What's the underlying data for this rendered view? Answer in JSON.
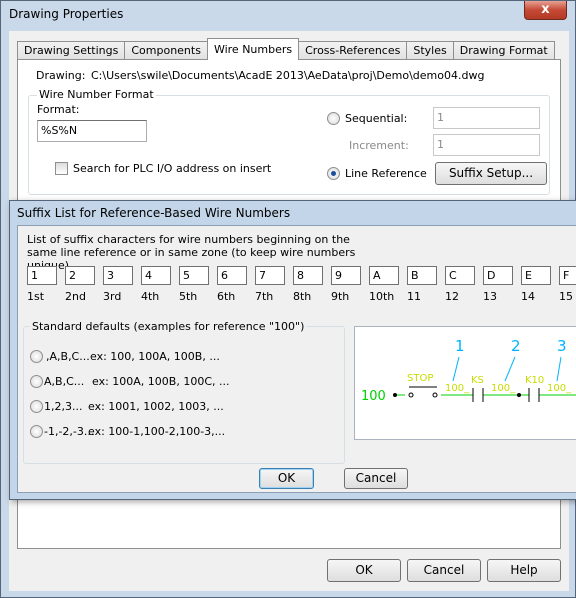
{
  "main": {
    "title": "Drawing Properties",
    "close_glyph": "x",
    "tabs": [
      "Drawing Settings",
      "Components",
      "Wire Numbers",
      "Cross-References",
      "Styles",
      "Drawing Format"
    ],
    "active_tab": "Wire Numbers",
    "drawing_label": "Drawing:",
    "drawing_path": "C:\\Users\\swile\\Documents\\AcadE 2013\\AeData\\proj\\Demo\\demo04.dwg",
    "group_label": "Wire Number Format",
    "format_label": "Format:",
    "format_value": "%S%N",
    "plc_label": "Search for PLC I/O address on insert",
    "sequential_label": "Sequential:",
    "sequential_value": "1",
    "increment_label": "Increment:",
    "increment_value": "1",
    "line_reference_label": "Line Reference",
    "suffix_button": "Suffix Setup...",
    "ok": "OK",
    "cancel": "Cancel",
    "help": "Help"
  },
  "suffix_dialog": {
    "title": "Suffix List for Reference-Based Wire Numbers",
    "description_line1": "List of suffix characters for wire numbers beginning on the",
    "description_line2": "same line reference or in same zone (to keep wire numbers unique).",
    "values": [
      "1",
      "2",
      "3",
      "4",
      "5",
      "6",
      "7",
      "8",
      "9",
      "A",
      "B",
      "C",
      "D",
      "E",
      "F"
    ],
    "ordinals": [
      "1st",
      "2nd",
      "3rd",
      "4th",
      "5th",
      "6th",
      "7th",
      "8th",
      "9th",
      "10th",
      "11",
      "12",
      "13",
      "14",
      "15"
    ],
    "defaults_label": "Standard defaults (examples for reference \"100\")",
    "defaults": [
      {
        "option": ",A,B,C...",
        "example": "ex: 100,  100A, 100B, ..."
      },
      {
        "option": "A,B,C...",
        "example": "ex: 100A, 100B, 100C, ..."
      },
      {
        "option": "1,2,3...",
        "example": "ex: 1001, 1002, 1003, ..."
      },
      {
        "option": "-1,-2,-3...",
        "example": "ex: 100-1,100-2,100-3,..."
      }
    ],
    "preview": {
      "wire_number": "100",
      "tags": [
        "1",
        "2",
        "3"
      ],
      "wire_labels": [
        "100_",
        "100_",
        "100_"
      ],
      "component_tags": [
        "STOP",
        "KS",
        "K10"
      ],
      "line_color": "#00d000",
      "tag_color": "#00b4ff",
      "label_color": "#c8dc00"
    },
    "ok": "OK",
    "cancel": "Cancel"
  }
}
